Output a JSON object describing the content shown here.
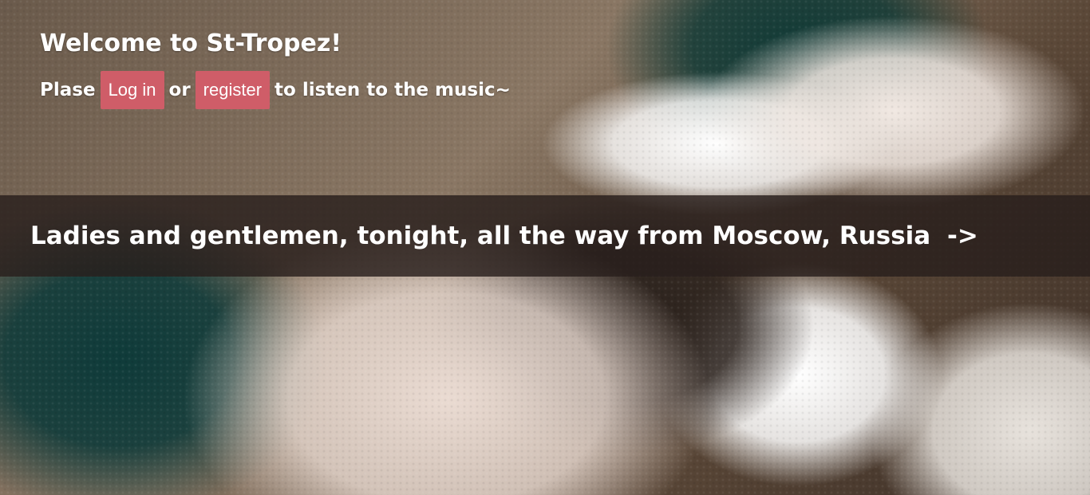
{
  "page": {
    "welcome_title": "Welcome to St-Tropez!",
    "login_prompt": {
      "prefix": "Plase",
      "login_label": "Log in",
      "or": "or",
      "register_label": "register",
      "suffix": "to listen to the music~"
    },
    "banner": {
      "text": "Ladies and gentlemen, tonight, all the way from Moscow, Russia",
      "arrow": "->"
    }
  },
  "colors": {
    "button": "#cf5d68",
    "banner_overlay": "#281e1c",
    "text": "#ffffff"
  }
}
